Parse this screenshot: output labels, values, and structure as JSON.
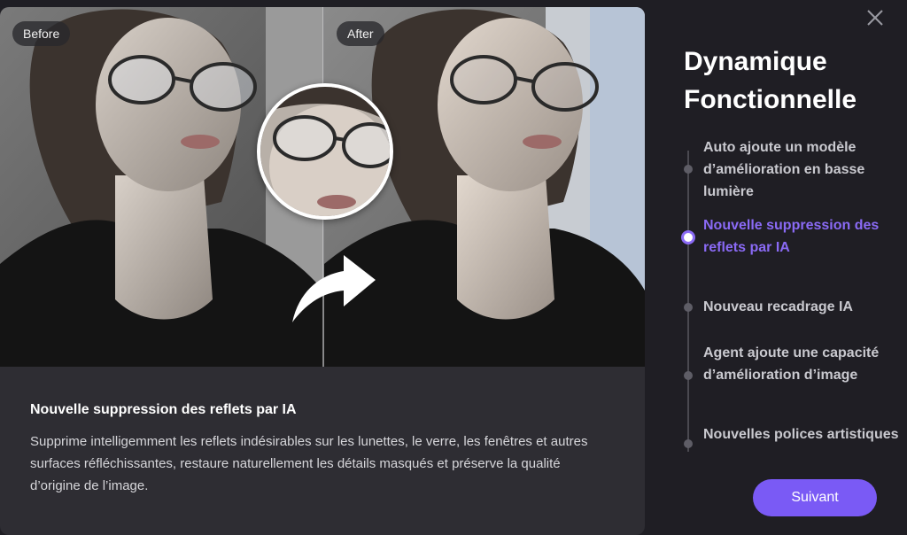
{
  "preview": {
    "before_label": "Before",
    "after_label": "After"
  },
  "info": {
    "title": "Nouvelle suppression des reflets par IA",
    "description": "Supprime intelligemment les reflets indésirables sur les lunettes, le verre, les fenêtres et autres surfaces réfléchissantes, restaure naturellement les détails masqués et préserve la qualité d’origine de l’image."
  },
  "panel": {
    "heading_line1": "Dynamique",
    "heading_line2": "Fonctionnelle",
    "steps": [
      {
        "label": "Auto ajoute un modèle d’amélioration en basse lumière",
        "active": false
      },
      {
        "label": "Nouvelle suppression des reflets par IA",
        "active": true
      },
      {
        "label": "Nouveau recadrage IA",
        "active": false
      },
      {
        "label": "Agent ajoute une capacité d’amélioration d’image",
        "active": false
      },
      {
        "label": "Nouvelles polices artistiques",
        "active": false
      }
    ],
    "next_label": "Suivant"
  },
  "colors": {
    "accent": "#7a5af5",
    "active_step": "#8a6af5",
    "background": "#1f1e24",
    "card": "#2e2d33"
  },
  "icons": {
    "close": "close-icon",
    "arrow": "curved-arrow-icon"
  }
}
